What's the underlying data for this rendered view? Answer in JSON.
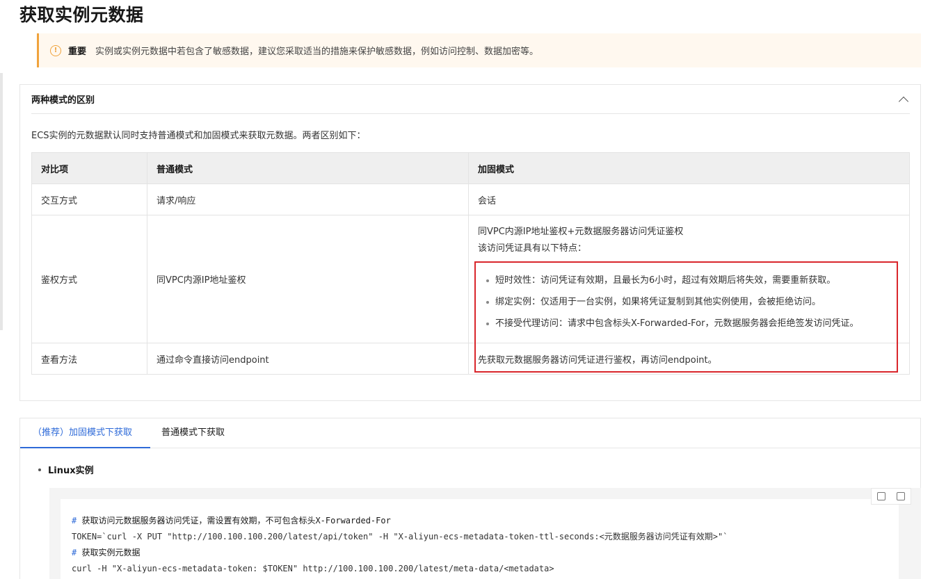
{
  "page": {
    "title": "获取实例元数据"
  },
  "notice": {
    "label": "重要",
    "text": "实例或实例元数据中若包含了敏感数据，建议您采取适当的措施来保护敏感数据，例如访问控制、数据加密等。",
    "icon": "warning-icon",
    "accent": "#f0a33c"
  },
  "panel": {
    "title": "两种模式的区别",
    "expanded": true,
    "description": "ECS实例的元数据默认同时支持普通模式和加固模式来获取元数据。两者区别如下：",
    "table": {
      "headers": [
        "对比项",
        "普通模式",
        "加固模式"
      ],
      "rows": [
        {
          "item": "交互方式",
          "normal": "请求/响应",
          "hardened": "会话"
        },
        {
          "item": "鉴权方式",
          "normal": "同VPC内源IP地址鉴权",
          "hardened_line1": "同VPC内源IP地址鉴权+元数据服务器访问凭证鉴权",
          "hardened_line2": "该访问凭证具有以下特点：",
          "hardened_bullets": [
            "短时效性：访问凭证有效期，且最长为6小时，超过有效期后将失效，需要重新获取。",
            "绑定实例：仅适用于一台实例，如果将凭证复制到其他实例使用，会被拒绝访问。",
            "不接受代理访问：请求中包含标头X-Forwarded-For，元数据服务器会拒绝签发访问凭证。"
          ]
        },
        {
          "item": "查看方法",
          "normal": "通过命令直接访问endpoint",
          "hardened": "先获取元数据服务器访问凭证进行鉴权，再访问endpoint。"
        }
      ]
    },
    "highlight_color": "#d9262b"
  },
  "tabs": {
    "items": [
      {
        "label": "（推荐）加固模式下获取",
        "active": true
      },
      {
        "label": "普通模式下获取",
        "active": false
      }
    ],
    "active_color": "#2e6ad8"
  },
  "content": {
    "os_label": "Linux实例",
    "code": {
      "line1_hash": "#",
      "line1_text": " 获取访问元数据服务器访问凭证，需设置有效期，不可包含标头X-Forwarded-For",
      "line2": "TOKEN=`curl -X PUT \"http://100.100.100.200/latest/api/token\" -H \"X-aliyun-ecs-metadata-token-ttl-seconds:<元数据服务器访问凭证有效期>\"`",
      "line3_hash": "#",
      "line3_text": " 获取实例元数据",
      "line4": "curl -H \"X-aliyun-ecs-metadata-token: $TOKEN\" http://100.100.100.200/latest/meta-data/<metadata>"
    }
  }
}
